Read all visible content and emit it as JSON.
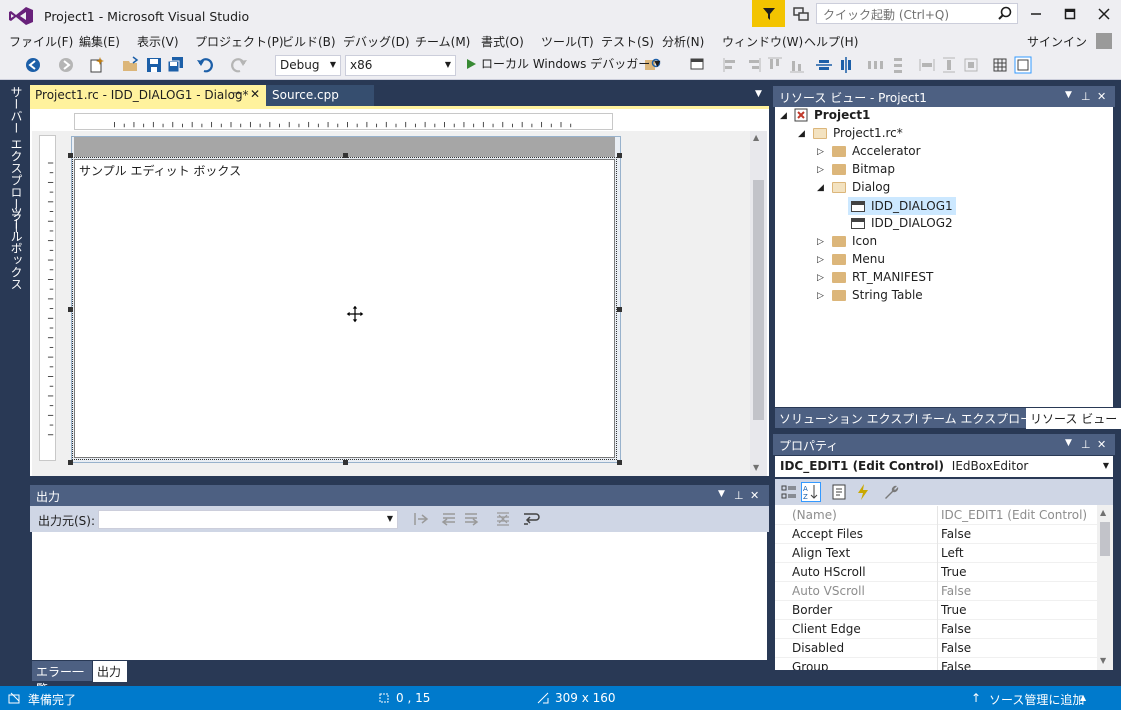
{
  "window": {
    "title": "Project1 - Microsoft Visual Studio",
    "quick_launch_placeholder": "クイック起動 (Ctrl+Q)",
    "sign_in": "サインイン"
  },
  "menu": [
    "ファイル(F)",
    "編集(E)",
    "表示(V)",
    "プロジェクト(P)",
    "ビルド(B)",
    "デバッグ(D)",
    "チーム(M)",
    "書式(O)",
    "ツール(T)",
    "テスト(S)",
    "分析(N)",
    "ウィンドウ(W)",
    "ヘルプ(H)"
  ],
  "toolbar": {
    "config": "Debug",
    "platform": "x86",
    "run_label": "ローカル Windows デバッガー"
  },
  "left_tabs": [
    "サーバー エクスプローラー",
    "ツールボックス"
  ],
  "doc_tabs": {
    "active": "Project1.rc - IDD_DIALOG1 - Dialog*",
    "other": "Source.cpp"
  },
  "editor": {
    "edit_text": "サンプル エディット ボックス"
  },
  "output": {
    "title": "出力",
    "source_label": "出力元(S):",
    "tabs": [
      "エラー一覧",
      "出力"
    ]
  },
  "resource_view": {
    "title": "リソース ビュー - Project1",
    "tree": {
      "root": "Project1",
      "rc": "Project1.rc*",
      "accelerator": "Accelerator",
      "bitmap": "Bitmap",
      "dialog": "Dialog",
      "dialog1": "IDD_DIALOG1",
      "dialog2": "IDD_DIALOG2",
      "icon": "Icon",
      "menu": "Menu",
      "manifest": "RT_MANIFEST",
      "stringtable": "String Table"
    },
    "tabs": [
      "ソリューション エクスプローラー",
      "チーム エクスプローラー",
      "リソース ビュー"
    ]
  },
  "properties": {
    "title": "プロパティ",
    "object": "IDC_EDIT1 (Edit Control)",
    "object_type": "IEdBoxEditor",
    "rows": [
      {
        "name": "(Name)",
        "value": "IDC_EDIT1 (Edit Control)"
      },
      {
        "name": "Accept Files",
        "value": "False"
      },
      {
        "name": "Align Text",
        "value": "Left"
      },
      {
        "name": "Auto HScroll",
        "value": "True"
      },
      {
        "name": "Auto VScroll",
        "value": "False"
      },
      {
        "name": "Border",
        "value": "True"
      },
      {
        "name": "Client Edge",
        "value": "False"
      },
      {
        "name": "Disabled",
        "value": "False"
      },
      {
        "name": "Group",
        "value": "False"
      }
    ]
  },
  "status": {
    "ready": "準備完了",
    "position": "0 , 15",
    "size": "309 x 160",
    "source_control": "ソース管理に追加"
  },
  "colors": {
    "accent": "#007acc",
    "active_tab": "#fff29d",
    "panel_title": "#4d6082"
  }
}
